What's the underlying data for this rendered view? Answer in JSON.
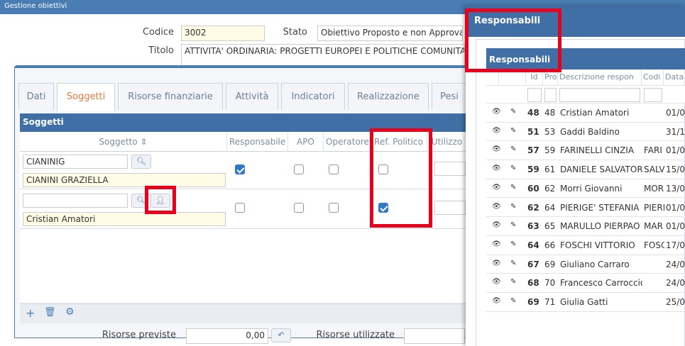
{
  "window": {
    "title": "Gestione obiettivi"
  },
  "header": {
    "codice_label": "Codice",
    "codice_value": "3002",
    "stato_label": "Stato",
    "stato_value": "Obiettivo Proposto e non Approvato",
    "titolo_label": "Titolo",
    "titolo_value": "ATTIVITA' ORDINARIA: PROGETTI EUROPEI E POLITICHE COMUNITARIE"
  },
  "tabs": [
    {
      "label": "Dati"
    },
    {
      "label": "Soggetti"
    },
    {
      "label": "Risorse finanziarie"
    },
    {
      "label": "Attività"
    },
    {
      "label": "Indicatori"
    },
    {
      "label": "Realizzazione"
    },
    {
      "label": "Pesi"
    }
  ],
  "soggetti": {
    "title": "Soggetti",
    "columns": [
      "Soggetto",
      "Responsabile",
      "APO",
      "Operatore",
      "Ref. Politico",
      "Utilizzo"
    ],
    "rows": [
      {
        "code": "CIANINIG",
        "name": "CIANINI GRAZIELLA",
        "responsabile": true,
        "apo": false,
        "operatore": false,
        "ref_politico": false
      },
      {
        "code": "",
        "name": "Cristian Amatori",
        "responsabile": false,
        "apo": false,
        "operatore": false,
        "ref_politico": true
      }
    ],
    "footer": {
      "risorse_previste_label": "Risorse previste",
      "risorse_previste_value": "0,00",
      "risorse_utilizzate_label": "Risorse utilizzate"
    }
  },
  "popup": {
    "title": "Responsabili",
    "grid_title": "Responsabili",
    "columns": [
      "Id",
      "Pro",
      "Descrizione respon",
      "Codi",
      "Data"
    ],
    "rows": [
      {
        "id": "48",
        "pro": "48",
        "desc": "Cristian Amatori",
        "cod": "",
        "data": "01/0"
      },
      {
        "id": "51",
        "pro": "53",
        "desc": "Gaddi Baldino",
        "cod": "",
        "data": "31/1"
      },
      {
        "id": "57",
        "pro": "59",
        "desc": "FARINELLI CINZIA",
        "cod": "FARI",
        "data": "01/0"
      },
      {
        "id": "59",
        "pro": "61",
        "desc": "DANIELE SALVATOR",
        "cod": "SALV",
        "data": "15/0"
      },
      {
        "id": "60",
        "pro": "62",
        "desc": "Morri Giovanni",
        "cod": "MOR",
        "data": "13/0"
      },
      {
        "id": "62",
        "pro": "64",
        "desc": "PIERIGE' STEFANIA",
        "cod": "PIERI",
        "data": "01/0"
      },
      {
        "id": "63",
        "pro": "65",
        "desc": "MARULLO PIERPAO",
        "cod": "MAR",
        "data": "01/0"
      },
      {
        "id": "64",
        "pro": "66",
        "desc": "FOSCHI VITTORIO",
        "cod": "FOSC",
        "data": "17/0"
      },
      {
        "id": "67",
        "pro": "69",
        "desc": "Giuliano Carraro",
        "cod": "",
        "data": "24/0"
      },
      {
        "id": "68",
        "pro": "70",
        "desc": "Francesco Carroccio",
        "cod": "",
        "data": "24/0"
      },
      {
        "id": "69",
        "pro": "71",
        "desc": "Giulia Gatti",
        "cod": "",
        "data": "25/0"
      }
    ]
  },
  "colors": {
    "accent": "#3f6fa5",
    "highlight": "#e8001c",
    "active_tab": "#e07b39"
  }
}
